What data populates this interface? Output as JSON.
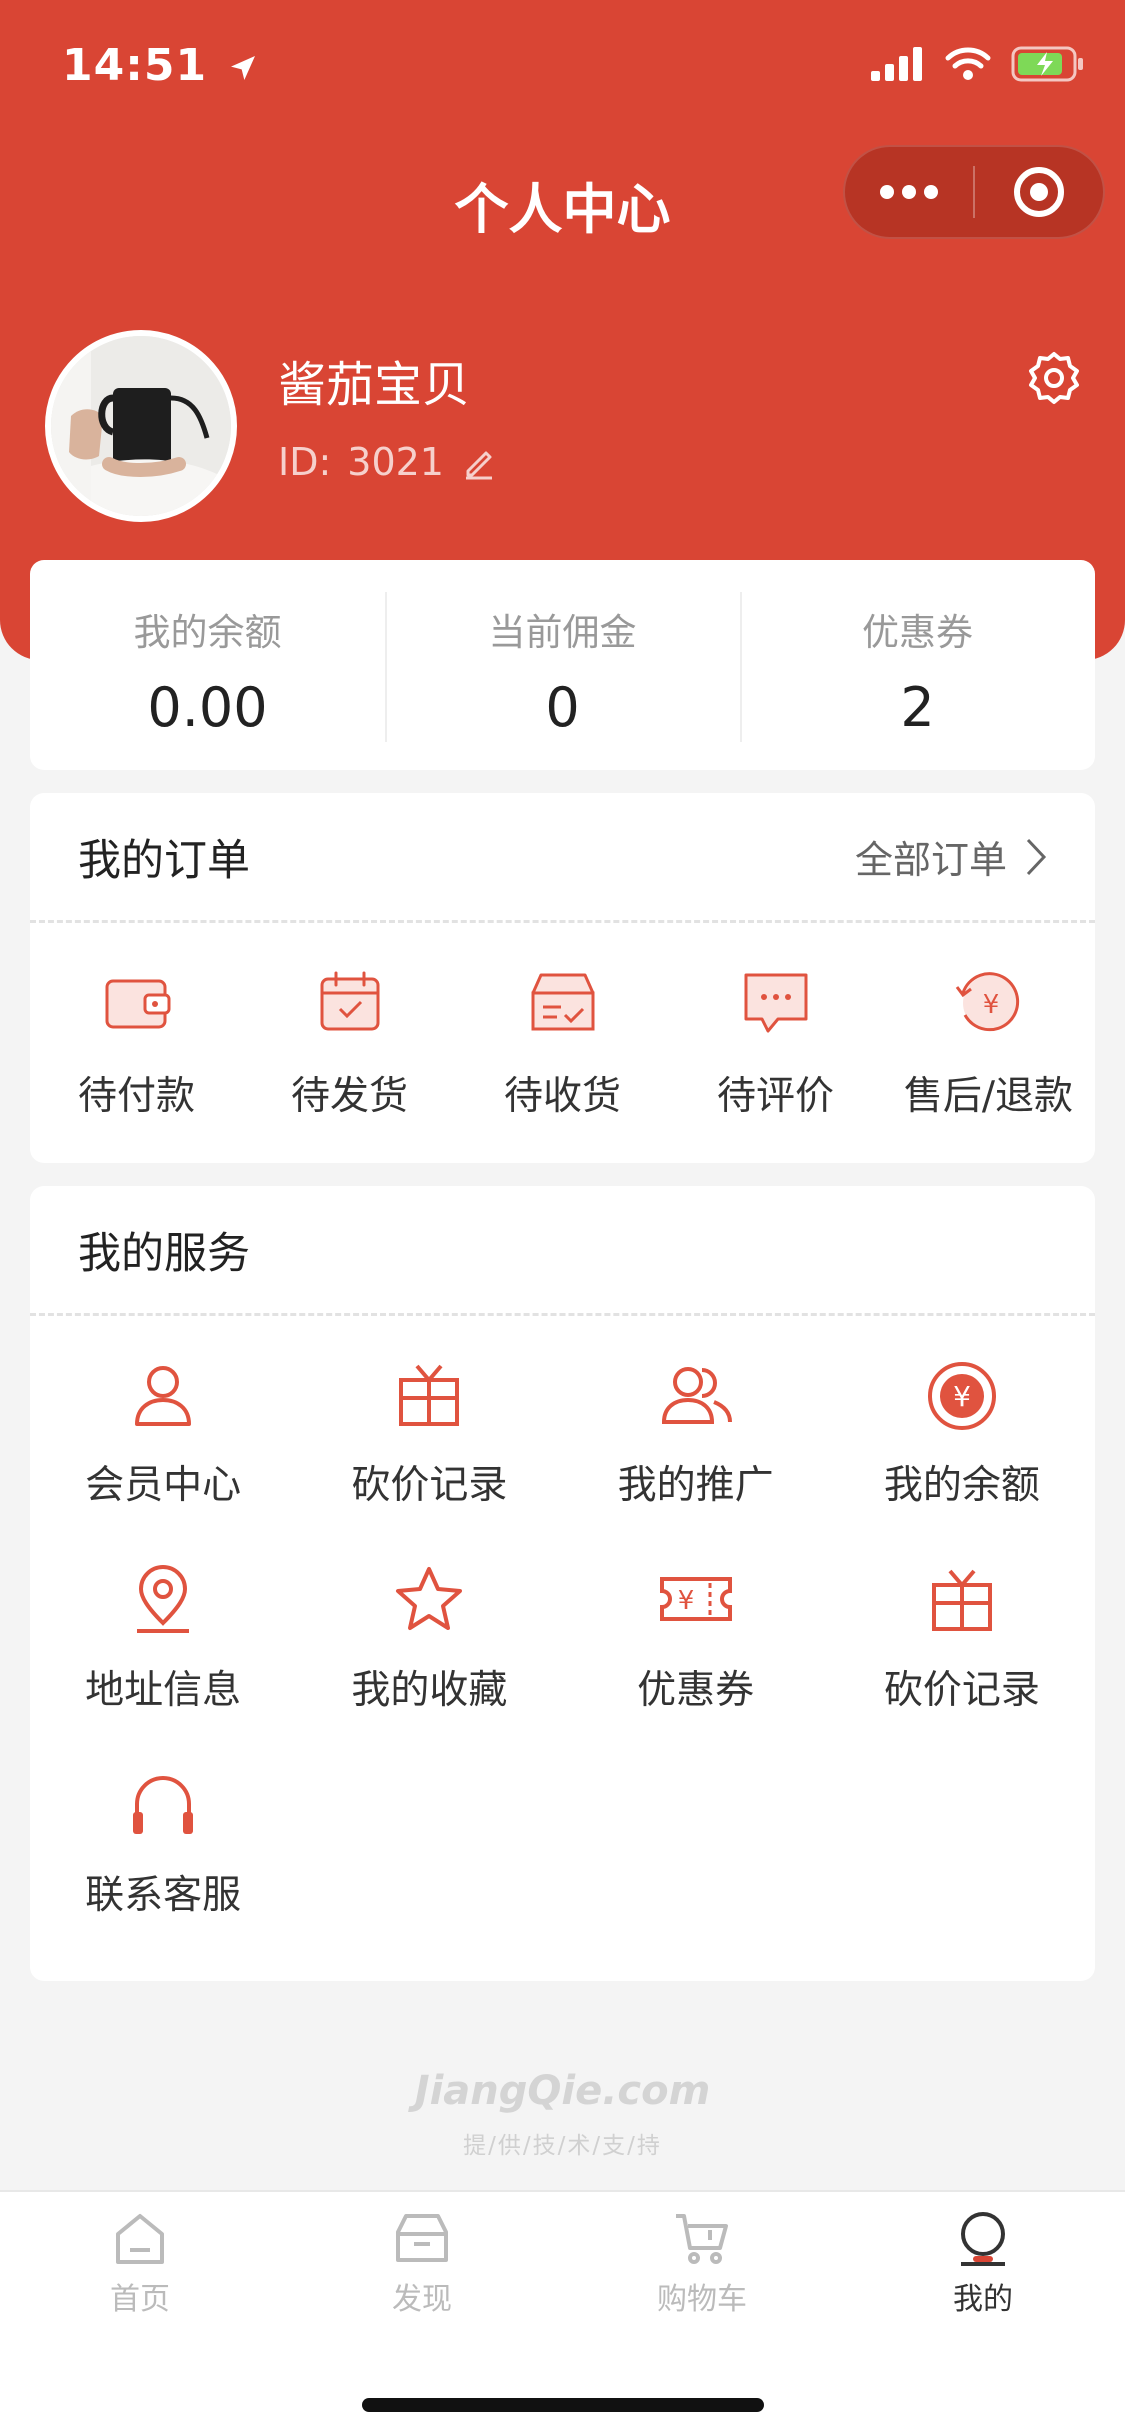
{
  "status": {
    "time": "14:51"
  },
  "nav": {
    "title": "个人中心"
  },
  "profile": {
    "name": "酱茄宝贝",
    "id_label": "ID:",
    "id_value": "3021"
  },
  "stats": [
    {
      "label": "我的余额",
      "value": "0.00"
    },
    {
      "label": "当前佣金",
      "value": "0"
    },
    {
      "label": "优惠券",
      "value": "2"
    }
  ],
  "orders": {
    "title": "我的订单",
    "all_label": "全部订单",
    "items": [
      {
        "label": "待付款",
        "icon": "wallet-icon"
      },
      {
        "label": "待发货",
        "icon": "calendar-check-icon"
      },
      {
        "label": "待收货",
        "icon": "box-icon"
      },
      {
        "label": "待评价",
        "icon": "comment-icon"
      },
      {
        "label": "售后/退款",
        "icon": "refund-icon"
      }
    ]
  },
  "services": {
    "title": "我的服务",
    "items": [
      {
        "label": "会员中心",
        "icon": "user-icon"
      },
      {
        "label": "砍价记录",
        "icon": "gift-icon"
      },
      {
        "label": "我的推广",
        "icon": "users-icon"
      },
      {
        "label": "我的余额",
        "icon": "yuan-coin-icon"
      },
      {
        "label": "地址信息",
        "icon": "location-icon"
      },
      {
        "label": "我的收藏",
        "icon": "star-icon"
      },
      {
        "label": "优惠券",
        "icon": "coupon-icon"
      },
      {
        "label": "砍价记录",
        "icon": "gift-icon"
      },
      {
        "label": "联系客服",
        "icon": "headset-icon"
      }
    ]
  },
  "footer": {
    "brand": "JiangQie.com",
    "sub": "提/供/技/术/支/持"
  },
  "tabs": [
    {
      "label": "首页",
      "icon": "home-icon"
    },
    {
      "label": "发现",
      "icon": "discover-icon"
    },
    {
      "label": "购物车",
      "icon": "cart-icon"
    },
    {
      "label": "我的",
      "icon": "profile-icon"
    }
  ],
  "colors": {
    "primary": "#d94534",
    "icon_red": "#e0533f"
  }
}
